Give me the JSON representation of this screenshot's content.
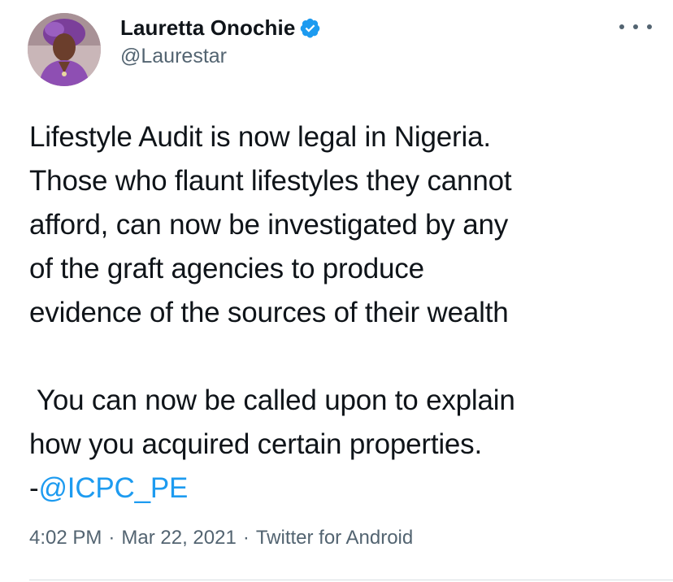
{
  "author": {
    "display_name": "Lauretta Onochie",
    "handle": "@Laurestar",
    "verified": true,
    "avatar_icon": "profile-photo",
    "verified_icon": "verified-badge-icon"
  },
  "more_icon": "more-options-icon",
  "tweet": {
    "line1": "Lifestyle Audit is now legal in Nigeria.",
    "line2": "Those who flaunt lifestyles they cannot",
    "line3": "afford, can now be investigated by any",
    "line4": "of the graft agencies to produce",
    "line5": "evidence of the sources of their wealth",
    "line6": " You can now be called upon to explain",
    "line7": "how you acquired certain properties.",
    "prefix": "-",
    "mention": "@ICPC_PE"
  },
  "meta": {
    "time": "4:02 PM",
    "separator": "·",
    "date": "Mar 22, 2021",
    "source": "Twitter for Android"
  },
  "colors": {
    "text": "#0f1419",
    "secondary": "#536471",
    "link": "#1d9bf0",
    "verified": "#1d9bf0"
  }
}
